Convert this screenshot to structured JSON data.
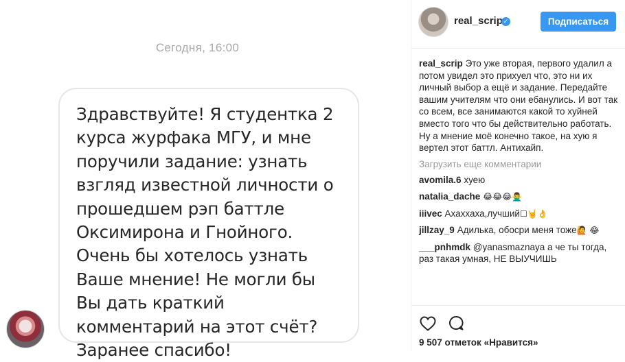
{
  "dm": {
    "date_label": "Сегодня, 16:00",
    "message": "Здравствуйте! Я студентка 2 курса журфака МГУ, и мне поручили задание: узнать взгляд известной личности о прошедшем рэп баттле Оксимирона и Гнойного. Очень бы хотелось узнать Ваше мнение! Не могли бы Вы дать краткий комментарий на этот счёт? Заранее спасибо!"
  },
  "header": {
    "username": "real_scrip",
    "verified_glyph": "✓",
    "follow_label": "Подписаться"
  },
  "caption": {
    "username": "real_scrip",
    "text": "Это уже вторая, первого удалил а потом увидел это прихуел что, это ни их личный выбор а ещё и задание. Передайте вашим учителям что они ебанулись. И вот так со всем, все занимаются какой то хуйней вместо того что бы действительно работать. Ну а мнение моё конечно такое, на хую я вертел этот баттл. Антихайп."
  },
  "load_more": "Загрузить еще комментарии",
  "comments": [
    {
      "username": "avomila.6",
      "text": "хуею",
      "emoji": ""
    },
    {
      "username": "natalia_dache",
      "text": "",
      "emoji": "😂😂😂🙅‍♂️"
    },
    {
      "username": "iiivec",
      "text": "Ахаххаха,лучший",
      "emoji": "☐🤘👌"
    },
    {
      "username": "jillzay_9",
      "text": "Адилька, обосри меня тоже",
      "emoji": "🙋 😂"
    },
    {
      "username": "___pnhmdk",
      "text": "@yanasmaznaya а че ты тогда, раз такая умная, НЕ ВЫУЧИШЬ",
      "emoji": ""
    }
  ],
  "likes_text": "9 507 отметок «Нравится»",
  "icons": [
    "heart-icon",
    "comment-icon",
    "verified-badge-icon"
  ],
  "colors": {
    "accent": "#3897f0",
    "muted": "#999999",
    "text": "#262626"
  }
}
